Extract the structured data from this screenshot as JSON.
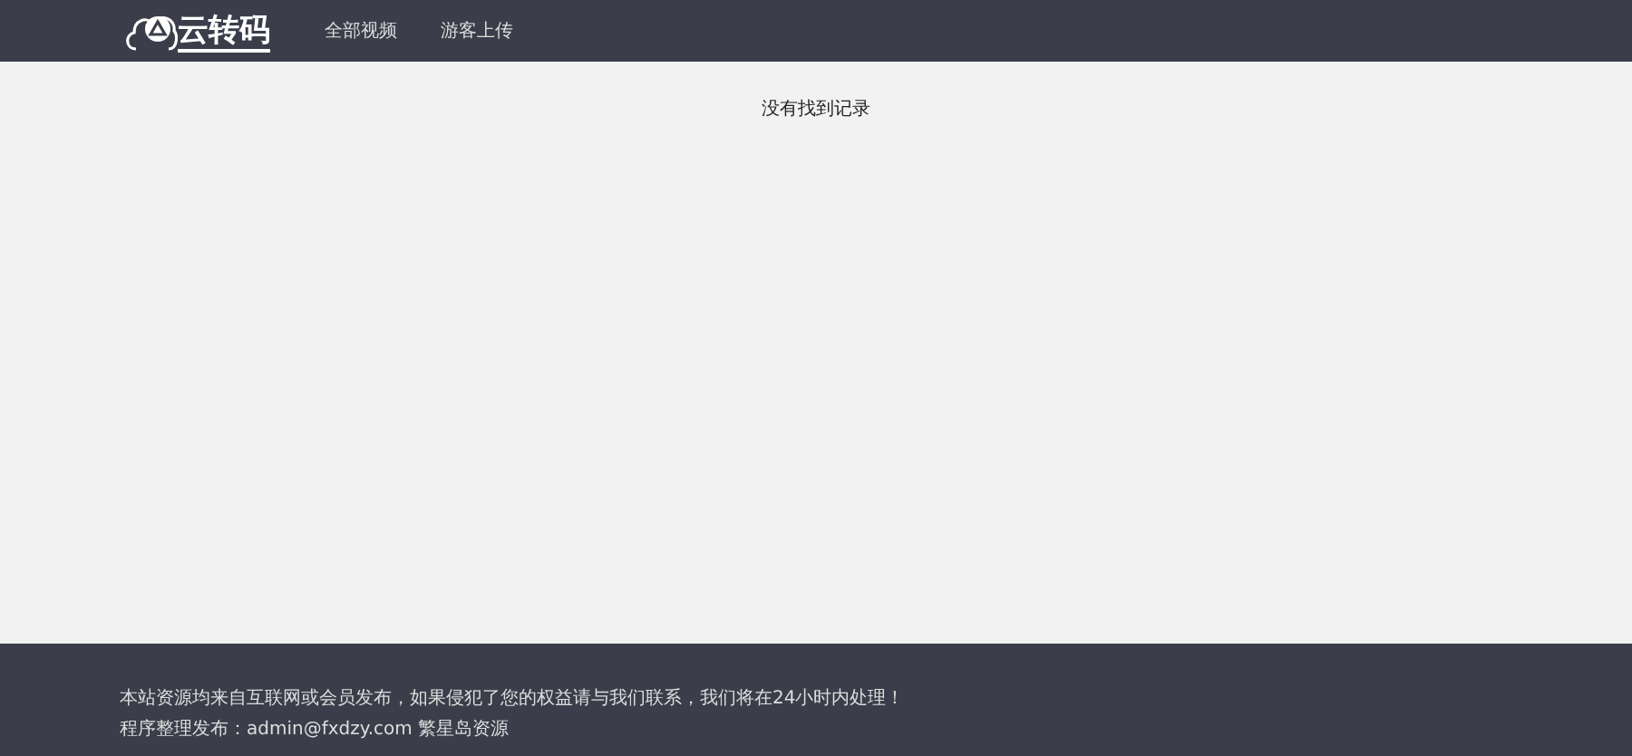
{
  "header": {
    "logo_text": "云转码",
    "nav": [
      {
        "label": "全部视频"
      },
      {
        "label": "游客上传"
      }
    ]
  },
  "main": {
    "empty_message": "没有找到记录"
  },
  "footer": {
    "lines": [
      "本站资源均来自互联网或会员发布，如果侵犯了您的权益请与我们联系，我们将在24小时内处理！",
      "程序整理发布：admin@fxdzy.com 繁星岛资源"
    ]
  }
}
